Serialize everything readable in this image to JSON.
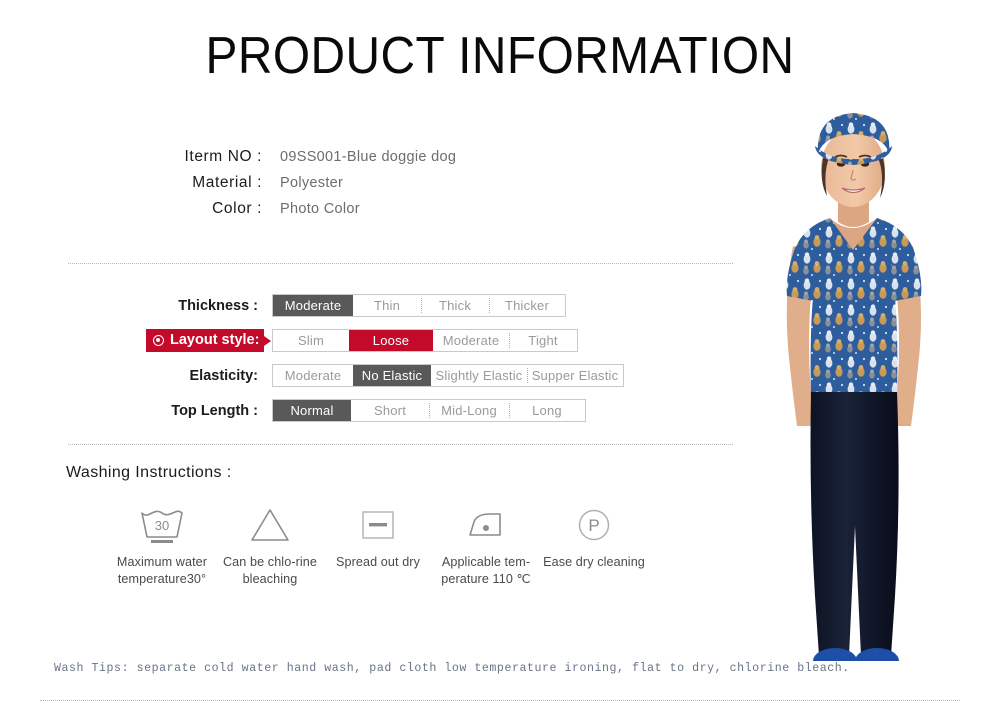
{
  "header": {
    "title": "PRODUCT INFORMATION"
  },
  "specs": [
    {
      "label": "Iterm NO :",
      "value": "09SS001-Blue doggie dog"
    },
    {
      "label": "Material  :",
      "value": "Polyester"
    },
    {
      "label": "Color :",
      "value": "Photo Color"
    }
  ],
  "attributes": [
    {
      "label": "Thickness :",
      "highlight": false,
      "options": [
        {
          "text": "Moderate",
          "selected": true
        },
        {
          "text": "Thin",
          "selected": false
        },
        {
          "text": "Thick",
          "selected": false
        },
        {
          "text": "Thicker",
          "selected": false
        }
      ]
    },
    {
      "label": "Layout style:",
      "highlight": true,
      "options": [
        {
          "text": "Slim",
          "selected": false
        },
        {
          "text": "Loose",
          "selected": true
        },
        {
          "text": "Moderate",
          "selected": false
        },
        {
          "text": "Tight",
          "selected": false
        }
      ]
    },
    {
      "label": "Elasticity:",
      "highlight": false,
      "options": [
        {
          "text": "Moderate",
          "selected": false
        },
        {
          "text": "No Elastic",
          "selected": true
        },
        {
          "text": "Slightly Elastic",
          "selected": false
        },
        {
          "text": "Supper  Elastic",
          "selected": false
        }
      ]
    },
    {
      "label": "Top Length :",
      "highlight": false,
      "options": [
        {
          "text": "Normal",
          "selected": true
        },
        {
          "text": "Short",
          "selected": false
        },
        {
          "text": "Mid-Long",
          "selected": false
        },
        {
          "text": "Long",
          "selected": false
        }
      ]
    }
  ],
  "washing": {
    "heading": "Washing Instructions :",
    "items": [
      {
        "icon": "wash-tub-30-icon",
        "temp": "30",
        "caption": "Maximum water temperature30°"
      },
      {
        "icon": "bleach-triangle-icon",
        "caption": "Can be chlo-rine bleaching"
      },
      {
        "icon": "flat-dry-square-icon",
        "caption": "Spread out dry"
      },
      {
        "icon": "iron-one-dot-icon",
        "caption": "Applicable tem-perature 110 ℃"
      },
      {
        "icon": "dry-clean-p-icon",
        "caption": "Ease dry cleaning"
      }
    ]
  },
  "wash_tips": {
    "text": "Wash Tips: separate cold water hand wash, pad cloth low temperature ironing, flat to dry, chlorine bleach."
  },
  "product_photo": {
    "alt": "Model wearing blue dog-print scrub top, cap and navy trousers"
  },
  "colors": {
    "accent_red": "#c30a2b",
    "selected_gray": "#595959",
    "scrub_blue": "#2e5d9e",
    "pants_navy": "#131a2e"
  }
}
